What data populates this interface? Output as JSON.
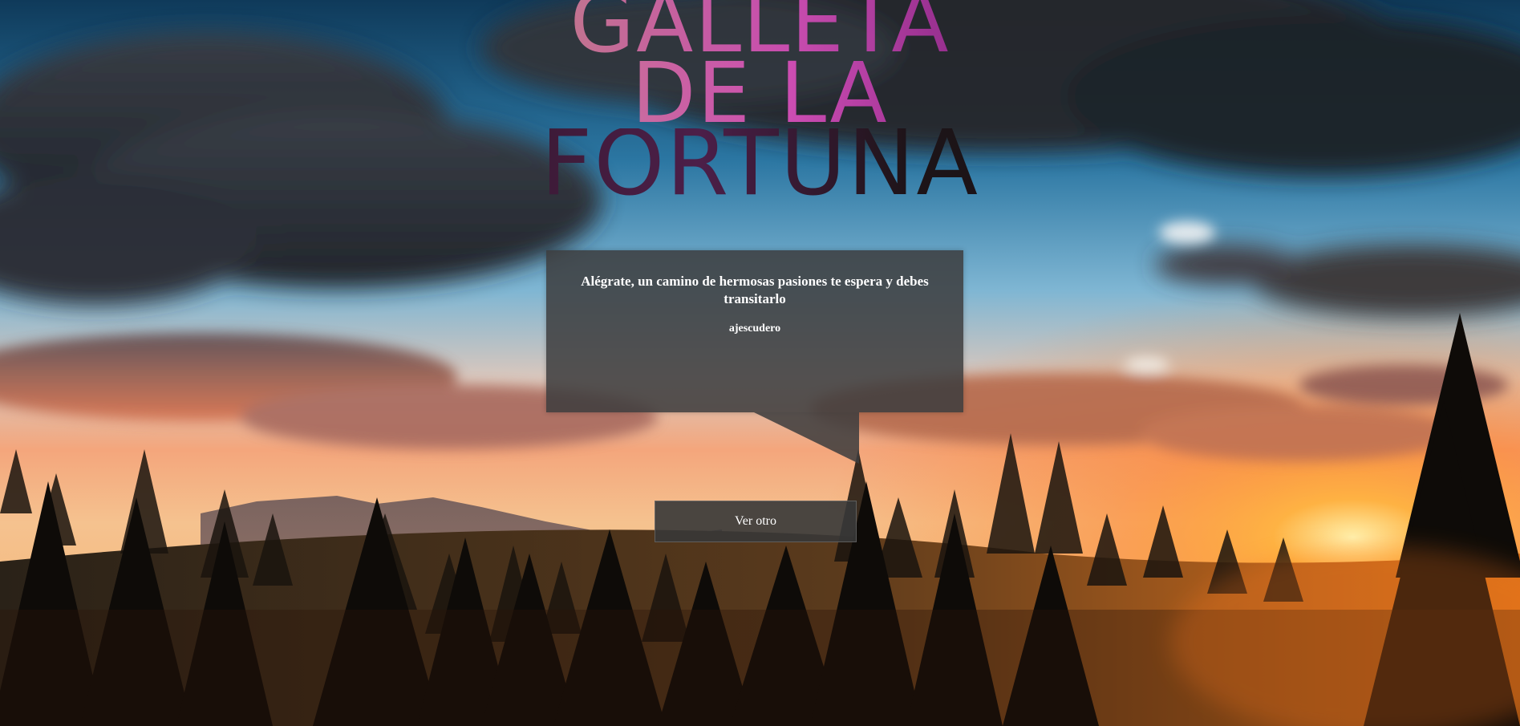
{
  "title": {
    "line1": "GALLETA",
    "line2": "DE LA",
    "line3": "FORTUNA"
  },
  "fortune": {
    "text": "Alégrate, un camino de hermosas pasiones te espera y debes transitarlo",
    "author": "ajescudero"
  },
  "actions": {
    "next_label": "Ver otro"
  },
  "colors": {
    "sky_top": "#2a6e98",
    "sunset": "#ff8a1e",
    "bubble": "#3c3c3e",
    "button": "#373737",
    "title_pink": "#d54fb9"
  }
}
